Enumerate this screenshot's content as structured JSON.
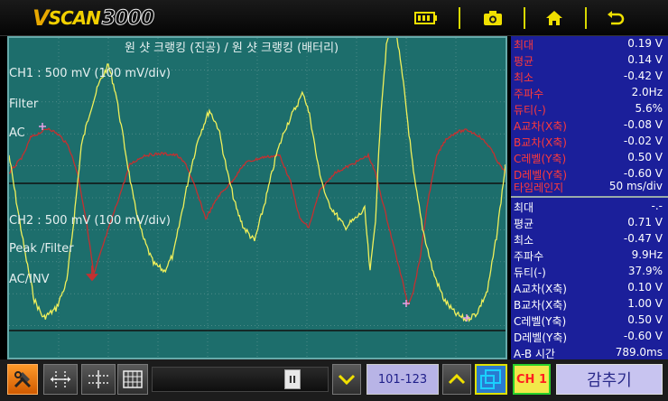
{
  "logo": {
    "v": "V",
    "scan": "SCAN",
    "num": "3000"
  },
  "top_icons": [
    "battery-icon",
    "camera-icon",
    "home-icon",
    "back-icon"
  ],
  "plot": {
    "title": "원 샷 크랭킹 (진공) / 원 샷 크랭킹 (배터리)",
    "ch1_label": "CH1 : 500 mV (100 mV/div)",
    "ch1_filter": "Filter",
    "ch1_coupling": "AC",
    "ch2_label": "CH2 : 500 mV (100 mV/div)",
    "ch2_filter": "Peak /Filter",
    "ch2_coupling": "AC/INV",
    "colors": {
      "background": "#1d6e6c",
      "grid": "#6a9a98",
      "ch1": "#f0f05a",
      "ch2": "#c43030"
    }
  },
  "readout_ch2": [
    {
      "label": "최대",
      "value": "0.19 V"
    },
    {
      "label": "평균",
      "value": "0.14 V"
    },
    {
      "label": "최소",
      "value": "-0.42 V"
    },
    {
      "label": "주파수",
      "value": "2.0Hz"
    },
    {
      "label": "듀티(-)",
      "value": "5.6%"
    },
    {
      "label": "A교차(X축)",
      "value": "-0.08 V"
    },
    {
      "label": "B교차(X축)",
      "value": "-0.02 V"
    },
    {
      "label": "C레벨(Y축)",
      "value": "0.50 V"
    },
    {
      "label": "D레벨(Y축)",
      "value": "-0.60 V"
    }
  ],
  "timescale": {
    "label": "타임레인지",
    "value": "50 ms/div"
  },
  "readout_ch1": [
    {
      "label": "최대",
      "value": "-.-"
    },
    {
      "label": "평균",
      "value": "0.71 V"
    },
    {
      "label": "최소",
      "value": "-0.47 V"
    },
    {
      "label": "주파수",
      "value": "9.9Hz"
    },
    {
      "label": "듀티(-)",
      "value": "37.9%"
    },
    {
      "label": "A교차(X축)",
      "value": "0.10 V"
    },
    {
      "label": "B교차(X축)",
      "value": "1.00 V"
    },
    {
      "label": "C레벨(Y축)",
      "value": "0.50 V"
    },
    {
      "label": "D레벨(Y축)",
      "value": "-0.60 V"
    },
    {
      "label": "A-B 시간",
      "value": "789.0ms"
    }
  ],
  "bottom": {
    "page_range": "101-123",
    "channel_button": "CH 1",
    "hide_button": "감추기",
    "pause_glyph": "II"
  }
}
